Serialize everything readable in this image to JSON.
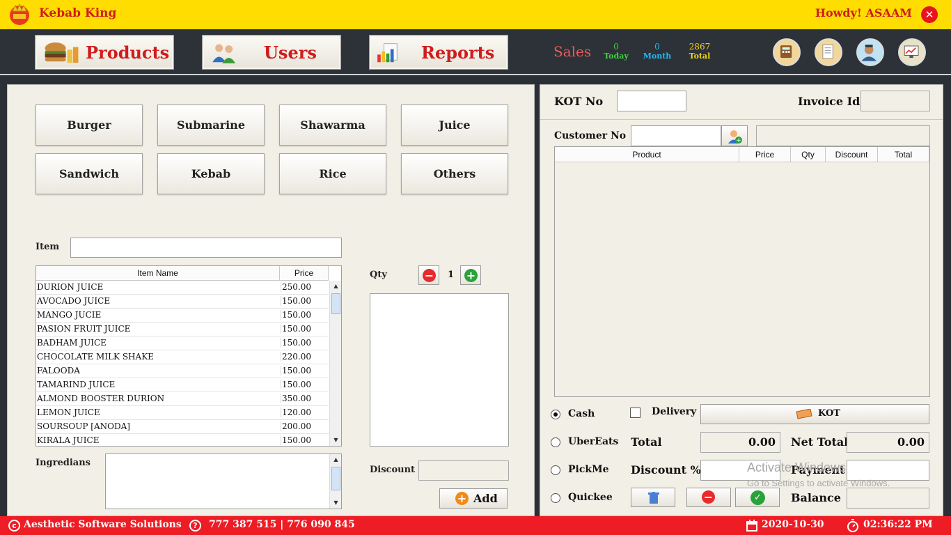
{
  "app": {
    "title": "Kebab King",
    "greeting": "Howdy! ASAAM"
  },
  "nav": {
    "products": "Products",
    "users": "Users",
    "reports": "Reports"
  },
  "sales": {
    "label": "Sales",
    "today_value": "0",
    "today_label": "Today",
    "month_value": "0",
    "month_label": "Month",
    "total_value": "2867",
    "total_label": "Total"
  },
  "categories": [
    "Burger",
    "Submarine",
    "Shawarma",
    "Juice",
    "Sandwich",
    "Kebab",
    "Rice",
    "Others"
  ],
  "item_search": {
    "label": "Item",
    "value": ""
  },
  "item_table": {
    "columns": [
      "Item Name",
      "Price"
    ],
    "rows": [
      {
        "name": "DURION JUICE",
        "price": "250.00"
      },
      {
        "name": "AVOCADO JUICE",
        "price": "150.00"
      },
      {
        "name": "MANGO JUCIE",
        "price": "150.00"
      },
      {
        "name": "PASION FRUIT JUICE",
        "price": "150.00"
      },
      {
        "name": "BADHAM JUICE",
        "price": "150.00"
      },
      {
        "name": "CHOCOLATE MILK SHAKE",
        "price": "220.00"
      },
      {
        "name": "FALOODA",
        "price": "150.00"
      },
      {
        "name": "TAMARIND JUICE",
        "price": "150.00"
      },
      {
        "name": "ALMOND BOOSTER DURION",
        "price": "350.00"
      },
      {
        "name": "LEMON JUICE",
        "price": "120.00"
      },
      {
        "name": "SOURSOUP [ANODA]",
        "price": "200.00"
      },
      {
        "name": "KIRALA JUICE",
        "price": "150.00"
      }
    ]
  },
  "qty": {
    "label": "Qty",
    "value": "1"
  },
  "ingredients": {
    "label": "Ingredians"
  },
  "discount": {
    "label": "Discount",
    "value": ""
  },
  "add_label": "Add",
  "order": {
    "kot_no_label": "KOT No",
    "invoice_label": "Invoice Id",
    "customer_label": "Customer No",
    "columns": [
      "Product",
      "Price",
      "Qty",
      "Discount",
      "Total"
    ]
  },
  "payment": {
    "cash": "Cash",
    "ubereats": "UberEats",
    "pickme": "PickMe",
    "quickee": "Quickee",
    "delivery": "Delivery",
    "kot_button": "KOT",
    "total_label": "Total",
    "total_value": "0.00",
    "net_total_label": "Net Total",
    "net_total_value": "0.00",
    "discount_pct_label": "Discount %",
    "payment_label": "Payment",
    "balance_label": "Balance"
  },
  "watermark": {
    "line1": "Activate Windows",
    "line2": "Go to Settings to activate Windows."
  },
  "footer": {
    "company": "Aesthetic Software Solutions",
    "phones": "777 387 515 | 776 090 845",
    "date": "2020-10-30",
    "time": "02:36:22 PM"
  },
  "colors": {
    "topbar": "#ffdd00",
    "navbar": "#2c3238",
    "accent_red": "#d01c1c",
    "footer": "#ee1c24"
  }
}
